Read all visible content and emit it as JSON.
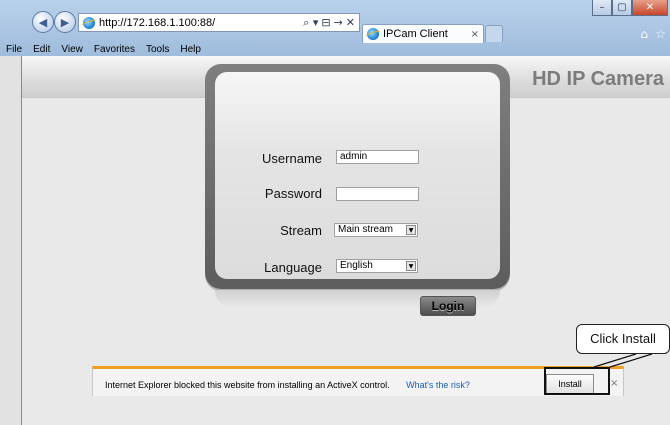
{
  "browser": {
    "address_url": "http://172.168.1.100:88/",
    "addr_tools": [
      "⌕ ▾",
      "⊟",
      "→",
      "✕"
    ],
    "tab_title": "IPCam Client",
    "tab_close": "×",
    "window_controls": [
      "–",
      "▢",
      "✕"
    ],
    "menu": [
      "File",
      "Edit",
      "View",
      "Favorites",
      "Tools",
      "Help"
    ]
  },
  "page": {
    "brand_title": "HD IP Camera"
  },
  "login": {
    "username_label": "Username",
    "username_value": "admin",
    "password_label": "Password",
    "password_value": "",
    "stream_label": "Stream",
    "stream_value": "Main stream",
    "language_label": "Language",
    "language_value": "English",
    "login_button": "Login"
  },
  "notification": {
    "message": "Internet Explorer blocked this website from installing an ActiveX control.",
    "risk_link": "What's the risk?",
    "install_button": "Install",
    "close": "×"
  },
  "callout": {
    "text": "Click Install"
  },
  "colors": {
    "notification_accent": "#f2a023",
    "link": "#1a5db5",
    "brand_text": "#7c7c7c"
  }
}
